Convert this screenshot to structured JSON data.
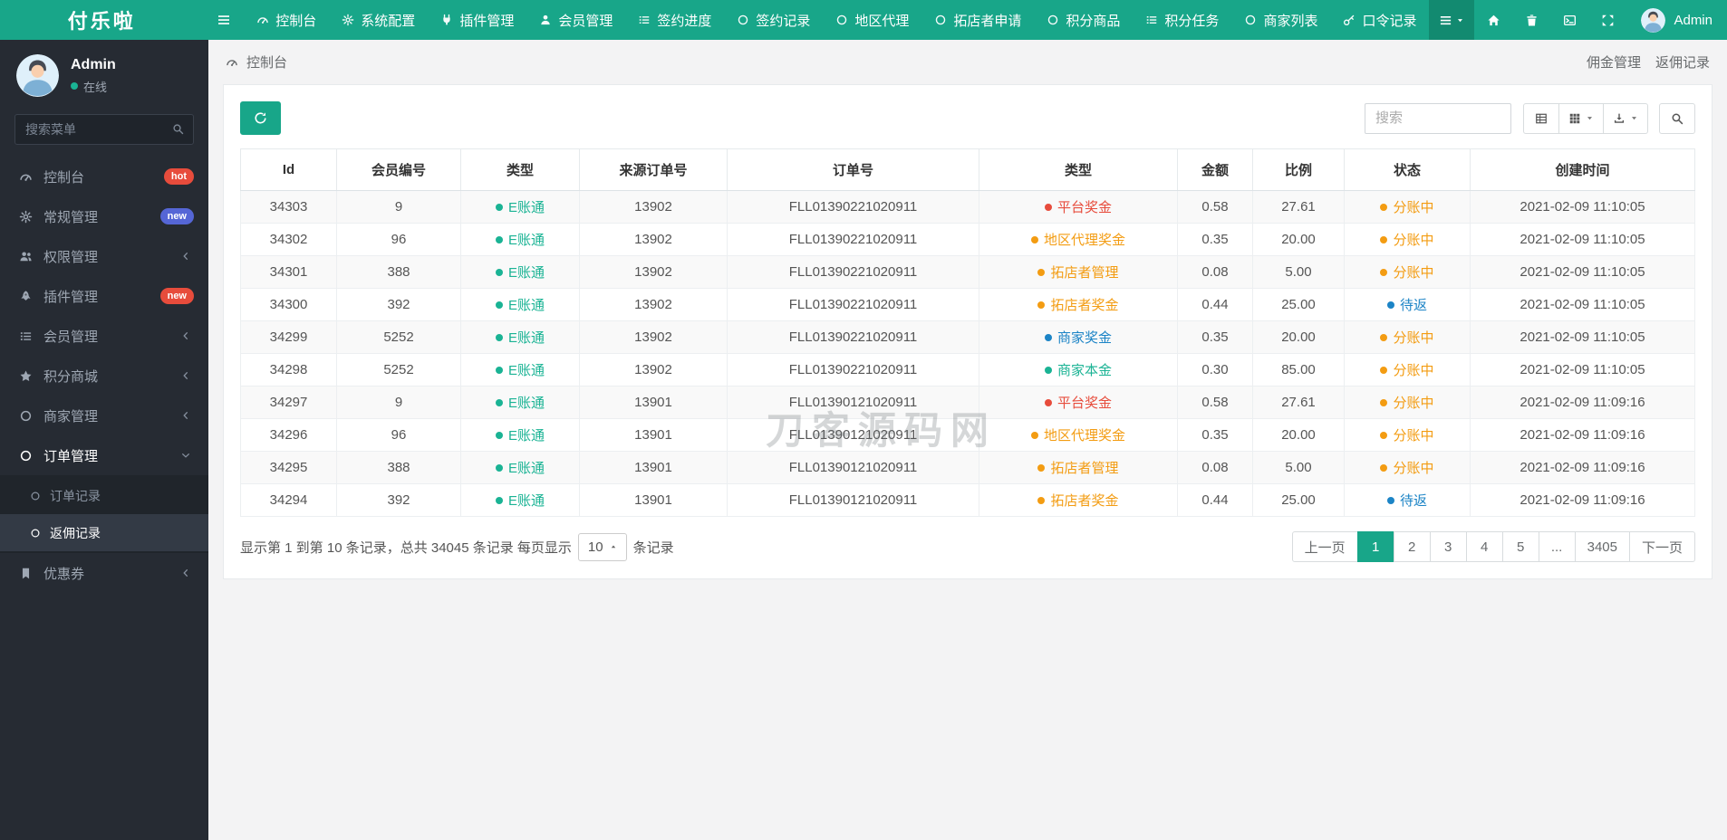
{
  "header": {
    "brand": "付乐啦",
    "nav_items": [
      {
        "label": "控制台",
        "icon": "gauge"
      },
      {
        "label": "系统配置",
        "icon": "gear"
      },
      {
        "label": "插件管理",
        "icon": "plug"
      },
      {
        "label": "会员管理",
        "icon": "user"
      },
      {
        "label": "签约进度",
        "icon": "list"
      },
      {
        "label": "签约记录",
        "icon": "circle"
      },
      {
        "label": "地区代理",
        "icon": "circle"
      },
      {
        "label": "拓店者申请",
        "icon": "circle"
      },
      {
        "label": "积分商品",
        "icon": "circle"
      },
      {
        "label": "积分任务",
        "icon": "list"
      },
      {
        "label": "商家列表",
        "icon": "circle"
      },
      {
        "label": "口令记录",
        "icon": "key"
      }
    ],
    "user_name": "Admin"
  },
  "sidebar": {
    "user_name": "Admin",
    "user_status": "在线",
    "search_placeholder": "搜索菜单",
    "items": [
      {
        "label": "控制台",
        "icon": "gauge",
        "badge": "hot",
        "badge_color": "#e74c3c"
      },
      {
        "label": "常规管理",
        "icon": "gear",
        "badge": "new",
        "badge_color": "#5566d6"
      },
      {
        "label": "权限管理",
        "icon": "users",
        "chevron": "left"
      },
      {
        "label": "插件管理",
        "icon": "rocket",
        "badge": "new",
        "badge_color": "#e74c3c"
      },
      {
        "label": "会员管理",
        "icon": "list",
        "chevron": "left"
      },
      {
        "label": "积分商城",
        "icon": "star",
        "chevron": "left"
      },
      {
        "label": "商家管理",
        "icon": "circle",
        "chevron": "left"
      },
      {
        "label": "订单管理",
        "icon": "circle",
        "chevron": "down",
        "active": true,
        "children": [
          {
            "label": "订单记录",
            "active": false
          },
          {
            "label": "返佣记录",
            "active": true
          }
        ]
      },
      {
        "label": "优惠券",
        "icon": "bookmark",
        "chevron": "left"
      }
    ]
  },
  "breadcrumb": {
    "left": "控制台",
    "parent": "佣金管理",
    "current": "返佣记录"
  },
  "toolbar": {
    "search_placeholder": "搜索"
  },
  "table": {
    "headers": [
      "Id",
      "会员编号",
      "类型",
      "来源订单号",
      "订单号",
      "类型",
      "金额",
      "比例",
      "状态",
      "创建时间"
    ],
    "rows": [
      {
        "id": "34303",
        "member_no": "9",
        "account_type": {
          "text": "E账通",
          "color": "green"
        },
        "source_order_no": "13902",
        "order_no": "FLL01390221020911",
        "bonus_type": {
          "text": "平台奖金",
          "color": "red"
        },
        "amount": "0.58",
        "ratio": "27.61",
        "status": {
          "text": "分账中",
          "color": "orange"
        },
        "created_at": "2021-02-09 11:10:05"
      },
      {
        "id": "34302",
        "member_no": "96",
        "account_type": {
          "text": "E账通",
          "color": "green"
        },
        "source_order_no": "13902",
        "order_no": "FLL01390221020911",
        "bonus_type": {
          "text": "地区代理奖金",
          "color": "orange"
        },
        "amount": "0.35",
        "ratio": "20.00",
        "status": {
          "text": "分账中",
          "color": "orange"
        },
        "created_at": "2021-02-09 11:10:05"
      },
      {
        "id": "34301",
        "member_no": "388",
        "account_type": {
          "text": "E账通",
          "color": "green"
        },
        "source_order_no": "13902",
        "order_no": "FLL01390221020911",
        "bonus_type": {
          "text": "拓店者管理",
          "color": "orange"
        },
        "amount": "0.08",
        "ratio": "5.00",
        "status": {
          "text": "分账中",
          "color": "orange"
        },
        "created_at": "2021-02-09 11:10:05"
      },
      {
        "id": "34300",
        "member_no": "392",
        "account_type": {
          "text": "E账通",
          "color": "green"
        },
        "source_order_no": "13902",
        "order_no": "FLL01390221020911",
        "bonus_type": {
          "text": "拓店者奖金",
          "color": "orange"
        },
        "amount": "0.44",
        "ratio": "25.00",
        "status": {
          "text": "待返",
          "color": "blue"
        },
        "created_at": "2021-02-09 11:10:05"
      },
      {
        "id": "34299",
        "member_no": "5252",
        "account_type": {
          "text": "E账通",
          "color": "green"
        },
        "source_order_no": "13902",
        "order_no": "FLL01390221020911",
        "bonus_type": {
          "text": "商家奖金",
          "color": "blue"
        },
        "amount": "0.35",
        "ratio": "20.00",
        "status": {
          "text": "分账中",
          "color": "orange"
        },
        "created_at": "2021-02-09 11:10:05"
      },
      {
        "id": "34298",
        "member_no": "5252",
        "account_type": {
          "text": "E账通",
          "color": "green"
        },
        "source_order_no": "13902",
        "order_no": "FLL01390221020911",
        "bonus_type": {
          "text": "商家本金",
          "color": "green"
        },
        "amount": "0.30",
        "ratio": "85.00",
        "status": {
          "text": "分账中",
          "color": "orange"
        },
        "created_at": "2021-02-09 11:10:05"
      },
      {
        "id": "34297",
        "member_no": "9",
        "account_type": {
          "text": "E账通",
          "color": "green"
        },
        "source_order_no": "13901",
        "order_no": "FLL01390121020911",
        "bonus_type": {
          "text": "平台奖金",
          "color": "red"
        },
        "amount": "0.58",
        "ratio": "27.61",
        "status": {
          "text": "分账中",
          "color": "orange"
        },
        "created_at": "2021-02-09 11:09:16"
      },
      {
        "id": "34296",
        "member_no": "96",
        "account_type": {
          "text": "E账通",
          "color": "green"
        },
        "source_order_no": "13901",
        "order_no": "FLL01390121020911",
        "bonus_type": {
          "text": "地区代理奖金",
          "color": "orange"
        },
        "amount": "0.35",
        "ratio": "20.00",
        "status": {
          "text": "分账中",
          "color": "orange"
        },
        "created_at": "2021-02-09 11:09:16"
      },
      {
        "id": "34295",
        "member_no": "388",
        "account_type": {
          "text": "E账通",
          "color": "green"
        },
        "source_order_no": "13901",
        "order_no": "FLL01390121020911",
        "bonus_type": {
          "text": "拓店者管理",
          "color": "orange"
        },
        "amount": "0.08",
        "ratio": "5.00",
        "status": {
          "text": "分账中",
          "color": "orange"
        },
        "created_at": "2021-02-09 11:09:16"
      },
      {
        "id": "34294",
        "member_no": "392",
        "account_type": {
          "text": "E账通",
          "color": "green"
        },
        "source_order_no": "13901",
        "order_no": "FLL01390121020911",
        "bonus_type": {
          "text": "拓店者奖金",
          "color": "orange"
        },
        "amount": "0.44",
        "ratio": "25.00",
        "status": {
          "text": "待返",
          "color": "blue"
        },
        "created_at": "2021-02-09 11:09:16"
      }
    ]
  },
  "footer": {
    "summary_prefix": "显示第 1 到第 10 条记录，总共 34045 条记录 每页显示",
    "page_size": "10",
    "summary_suffix": "条记录",
    "pages": [
      {
        "label": "上一页",
        "type": "prev"
      },
      {
        "label": "1",
        "active": true
      },
      {
        "label": "2"
      },
      {
        "label": "3"
      },
      {
        "label": "4"
      },
      {
        "label": "5"
      },
      {
        "label": "...",
        "type": "ellipsis"
      },
      {
        "label": "3405"
      },
      {
        "label": "下一页",
        "type": "next"
      }
    ]
  },
  "watermark": "刀客源码网",
  "colors": {
    "accent": "#18a689",
    "green": "#1ab394",
    "red": "#e74c3c",
    "orange": "#f39c12",
    "blue": "#1c84c6"
  }
}
